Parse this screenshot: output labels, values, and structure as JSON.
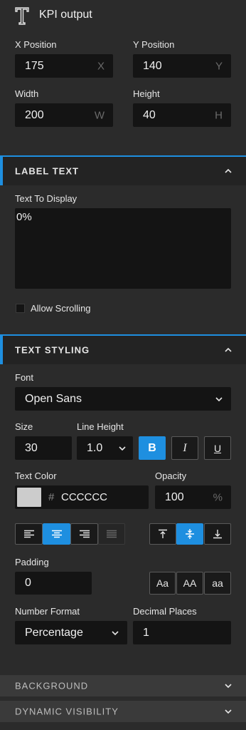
{
  "header": {
    "title": "KPI output",
    "icon": "text-type-icon"
  },
  "position": {
    "x_label": "X Position",
    "x_value": "175",
    "x_unit": "X",
    "y_label": "Y Position",
    "y_value": "140",
    "y_unit": "Y",
    "w_label": "Width",
    "w_value": "200",
    "w_unit": "W",
    "h_label": "Height",
    "h_value": "40",
    "h_unit": "H"
  },
  "label_text": {
    "section_title": "LABEL TEXT",
    "display_label": "Text To Display",
    "display_value": "0%",
    "scroll_label": "Allow Scrolling",
    "scroll_checked": false
  },
  "text_styling": {
    "section_title": "TEXT STYLING",
    "font_label": "Font",
    "font_value": "Open Sans",
    "size_label": "Size",
    "size_value": "30",
    "line_height_label": "Line Height",
    "line_height_value": "1.0",
    "bold_label": "B",
    "italic_label": "I",
    "underline_label": "U",
    "bold_active": true,
    "color_label": "Text Color",
    "color_hash": "#",
    "color_value": "CCCCCC",
    "color_swatch": "#cccccc",
    "opacity_label": "Opacity",
    "opacity_value": "100",
    "opacity_unit": "%",
    "align_active": "center",
    "valign_active": "middle",
    "padding_label": "Padding",
    "padding_value": "0",
    "case_title": "Aa",
    "case_upper": "AA",
    "case_lower": "aa",
    "number_format_label": "Number Format",
    "number_format_value": "Percentage",
    "decimal_label": "Decimal Places",
    "decimal_value": "1"
  },
  "collapsed": {
    "background_title": "BACKGROUND",
    "visibility_title": "DYNAMIC VISIBILITY"
  },
  "colors": {
    "accent": "#1e8fe0",
    "panel": "#2b2b2b",
    "field": "#141414"
  }
}
